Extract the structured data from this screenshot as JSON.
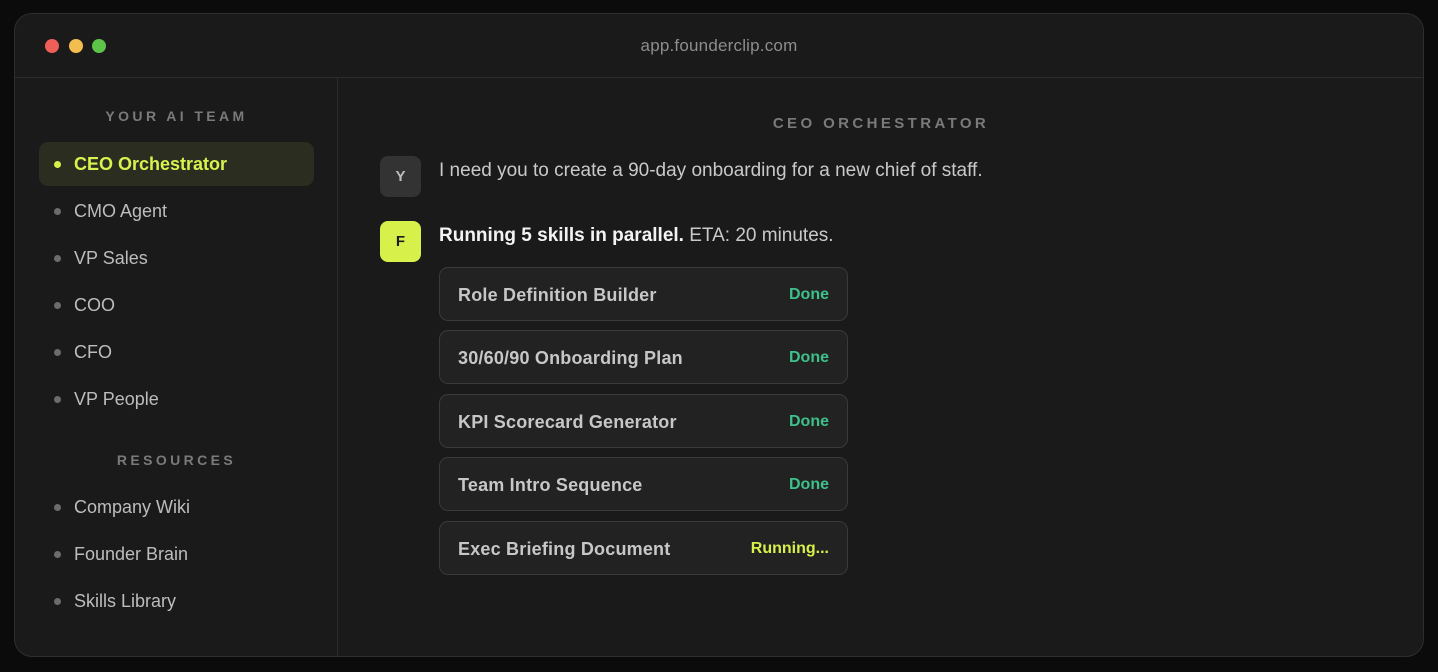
{
  "window": {
    "url": "app.founderclip.com"
  },
  "sidebar": {
    "team_heading": "YOUR AI TEAM",
    "team_items": [
      {
        "label": "CEO Orchestrator",
        "active": true
      },
      {
        "label": "CMO Agent",
        "active": false
      },
      {
        "label": "VP Sales",
        "active": false
      },
      {
        "label": "COO",
        "active": false
      },
      {
        "label": "CFO",
        "active": false
      },
      {
        "label": "VP People",
        "active": false
      }
    ],
    "resources_heading": "RESOURCES",
    "resource_items": [
      {
        "label": "Company Wiki"
      },
      {
        "label": "Founder Brain"
      },
      {
        "label": "Skills Library"
      }
    ]
  },
  "main": {
    "title": "CEO ORCHESTRATOR",
    "user_message": {
      "avatar": "Y",
      "text": "I need you to create a 90-day onboarding for a new chief of staff."
    },
    "bot_message": {
      "avatar": "F",
      "bold_text": "Running 5 skills in parallel.",
      "text": " ETA: 20 minutes."
    },
    "skills": [
      {
        "name": "Role Definition Builder",
        "status": "Done"
      },
      {
        "name": "30/60/90 Onboarding Plan",
        "status": "Done"
      },
      {
        "name": "KPI Scorecard Generator",
        "status": "Done"
      },
      {
        "name": "Team Intro Sequence",
        "status": "Done"
      },
      {
        "name": "Exec Briefing Document",
        "status": "Running..."
      }
    ]
  },
  "colors": {
    "accent": "#d8f04a",
    "done": "#3ec08c",
    "running": "#d8f04a",
    "background": "#1a1a1a"
  }
}
